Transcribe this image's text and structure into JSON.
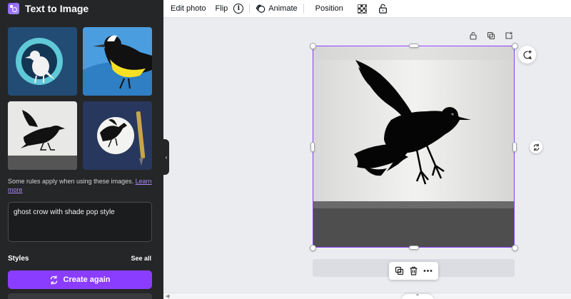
{
  "panel": {
    "title": "Text to Image",
    "rules_text": "Some rules apply when using these images. ",
    "rules_link": "Learn more",
    "prompt": "ghost crow with shade  pop style",
    "styles_label": "Styles",
    "see_all": "See all",
    "create_label": "Create again",
    "accent": "#8b3dff",
    "background": "#252627"
  },
  "toolbar": {
    "edit_photo": "Edit photo",
    "flip": "Flip",
    "animate": "Animate",
    "position": "Position",
    "icons": [
      "info-icon",
      "animate-icon",
      "transparency-icon",
      "lock-icon"
    ]
  },
  "canvas": {
    "page_icons": [
      "lock-icon",
      "duplicate-icon",
      "add-page-icon"
    ],
    "float_toolbar_icons": [
      "copy-icon",
      "trash-icon",
      "more-icon"
    ],
    "selection_color": "#8b3dff"
  },
  "thumbnails": [
    {
      "name": "thumb-crow-circle"
    },
    {
      "name": "thumb-yellow-bird"
    },
    {
      "name": "thumb-crow-wall"
    },
    {
      "name": "thumb-crow-moon-pen"
    }
  ]
}
